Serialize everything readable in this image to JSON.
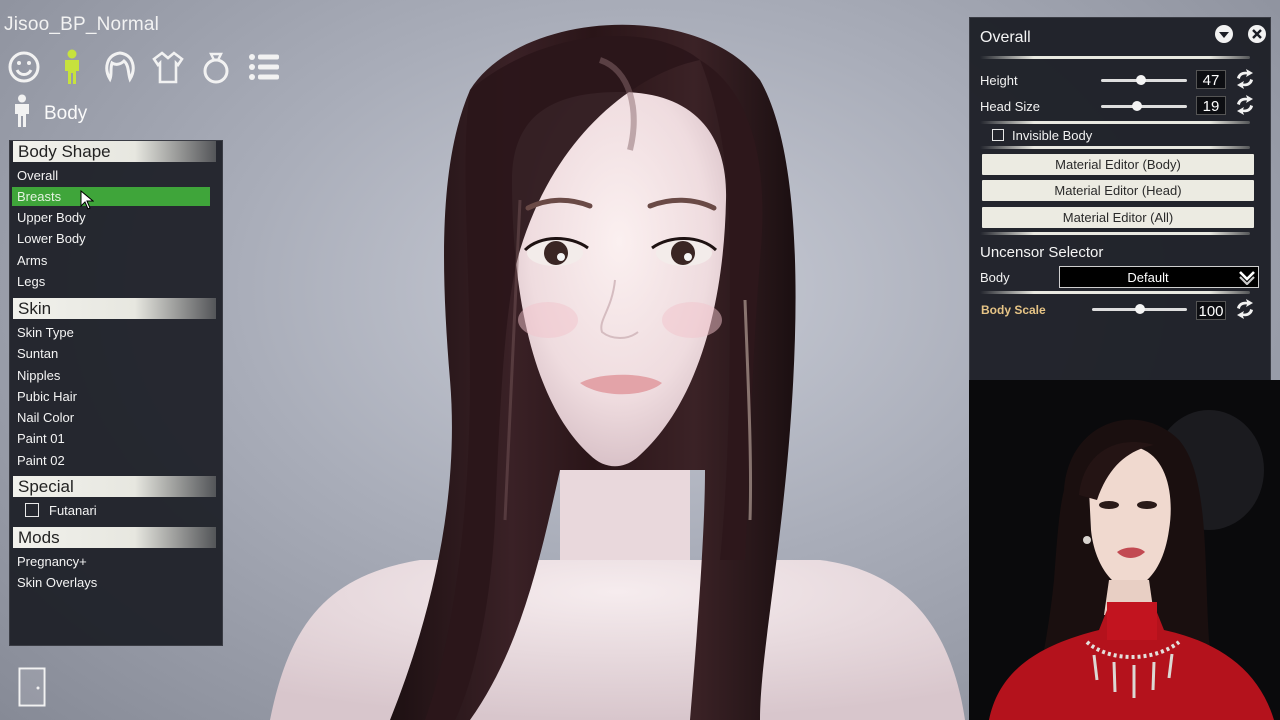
{
  "scene_title": "Jisoo_BP_Normal",
  "category_icons": [
    "face-icon",
    "body-icon",
    "hair-icon",
    "clothes-icon",
    "accessory-icon",
    "list-icon"
  ],
  "section": {
    "icon": "body-icon",
    "title": "Body"
  },
  "left_menu": {
    "body_shape": {
      "header": "Body Shape",
      "items": [
        "Overall",
        "Breasts",
        "Upper Body",
        "Lower Body",
        "Arms",
        "Legs"
      ],
      "active": "Breasts"
    },
    "skin": {
      "header": "Skin",
      "items": [
        "Skin Type",
        "Suntan",
        "Nipples",
        "Pubic Hair",
        "Nail Color",
        "Paint 01",
        "Paint 02"
      ]
    },
    "special": {
      "header": "Special",
      "futanari_label": "Futanari",
      "futanari_checked": false
    },
    "mods": {
      "header": "Mods",
      "items": [
        "Pregnancy+",
        "Skin Overlays"
      ]
    }
  },
  "right_panel": {
    "title": "Overall",
    "height": {
      "label": "Height",
      "value": "47",
      "fraction": 0.47
    },
    "head_size": {
      "label": "Head Size",
      "value": "19",
      "fraction": 0.42
    },
    "invisible_body": {
      "label": "Invisible Body",
      "checked": false
    },
    "material_buttons": [
      "Material Editor (Body)",
      "Material Editor (Head)",
      "Material Editor (All)"
    ],
    "uncensor": {
      "title": "Uncensor Selector",
      "body_label": "Body",
      "body_value": "Default",
      "scale_label": "Body Scale",
      "scale_value": "100",
      "scale_fraction": 0.5
    }
  },
  "colors": {
    "active_item": "#3fa53a",
    "panel_bg": "#1b1d25",
    "header_bg": "#ecebe2",
    "body_scale_label": "#e6c486"
  }
}
